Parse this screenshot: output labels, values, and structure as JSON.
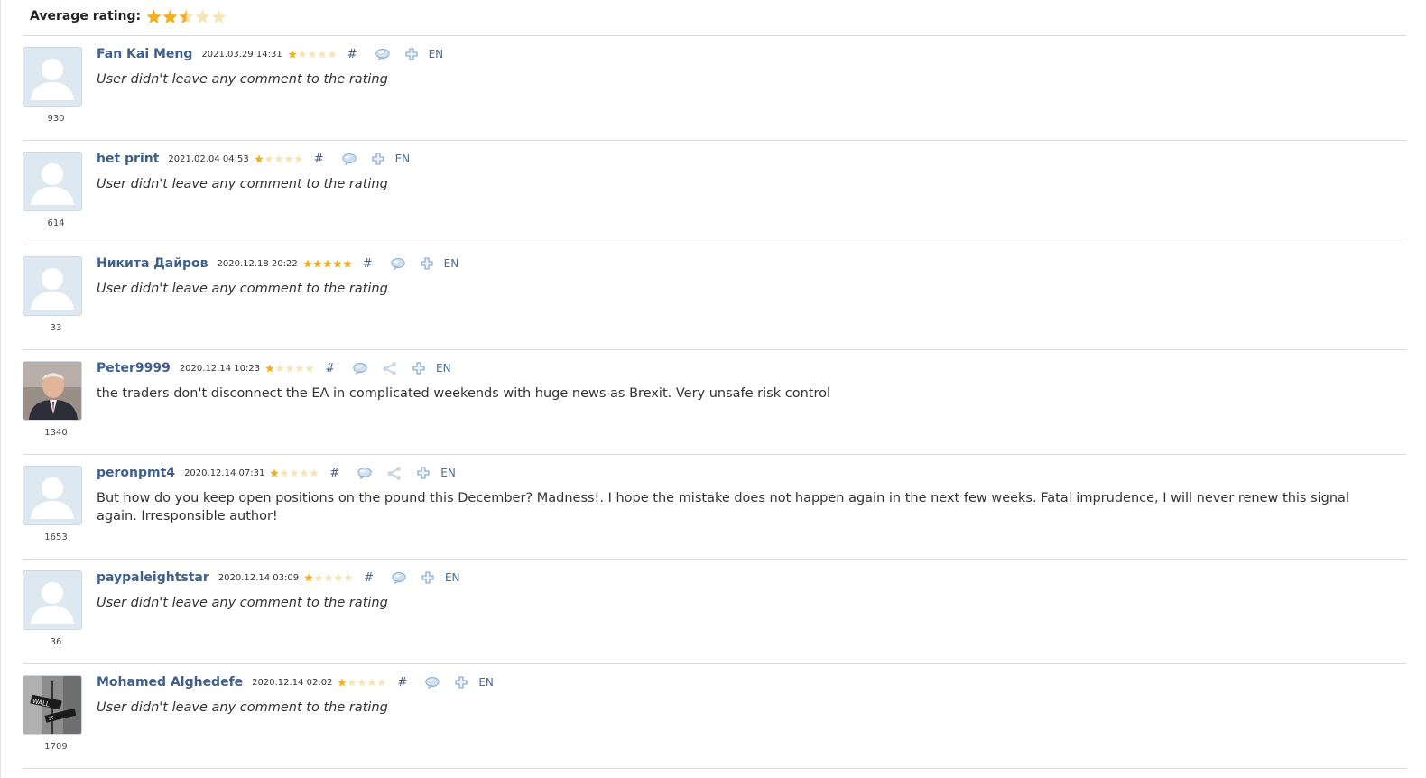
{
  "header": {
    "average_label": "Average rating:",
    "average_rating": 2.5,
    "max_rating": 5
  },
  "colors": {
    "accent_link": "#3f5f8c",
    "star_filled": "#f2b01e",
    "star_empty": "#f5e6b8",
    "avatar_bg": "#dde8f1"
  },
  "reviews": [
    {
      "author": "Fan Kai Meng",
      "date": "2021.03.29 14:31",
      "rating": 1,
      "hash": "#",
      "lang": "EN",
      "user_id": "930",
      "comment": "User didn't leave any comment to the rating",
      "no_comment": true,
      "has_share": false,
      "avatar": "default-avatar"
    },
    {
      "author": "het print",
      "date": "2021.02.04 04:53",
      "rating": 1,
      "hash": "#",
      "lang": "EN",
      "user_id": "614",
      "comment": "User didn't leave any comment to the rating",
      "no_comment": true,
      "has_share": false,
      "avatar": "default-avatar"
    },
    {
      "author": "Никита Дайров",
      "date": "2020.12.18 20:22",
      "rating": 5,
      "hash": "#",
      "lang": "EN",
      "user_id": "33",
      "comment": "User didn't leave any comment to the rating",
      "no_comment": true,
      "has_share": false,
      "avatar": "default-avatar"
    },
    {
      "author": "Peter9999",
      "date": "2020.12.14 10:23",
      "rating": 1,
      "hash": "#",
      "lang": "EN",
      "user_id": "1340",
      "comment": "the traders don't disconnect the EA in complicated weekends with huge news as Brexit. Very unsafe risk control",
      "no_comment": false,
      "has_share": true,
      "avatar": "portrait-avatar"
    },
    {
      "author": "peronpmt4",
      "date": "2020.12.14 07:31",
      "rating": 1,
      "hash": "#",
      "lang": "EN",
      "user_id": "1653",
      "comment": "But how do you keep open positions on the pound this December? Madness!. I hope the mistake does not happen again in the next few weeks. Fatal imprudence, I will never renew this signal again. Irresponsible author!",
      "no_comment": false,
      "has_share": true,
      "avatar": "default-avatar"
    },
    {
      "author": "paypaleightstar",
      "date": "2020.12.14 03:09",
      "rating": 1,
      "hash": "#",
      "lang": "EN",
      "user_id": "36",
      "comment": "User didn't leave any comment to the rating",
      "no_comment": true,
      "has_share": false,
      "avatar": "default-avatar"
    },
    {
      "author": "Mohamed Alghedefe",
      "date": "2020.12.14 02:02",
      "rating": 1,
      "hash": "#",
      "lang": "EN",
      "user_id": "1709",
      "comment": "User didn't leave any comment to the rating",
      "no_comment": true,
      "has_share": false,
      "avatar": "wall-street-avatar"
    }
  ]
}
